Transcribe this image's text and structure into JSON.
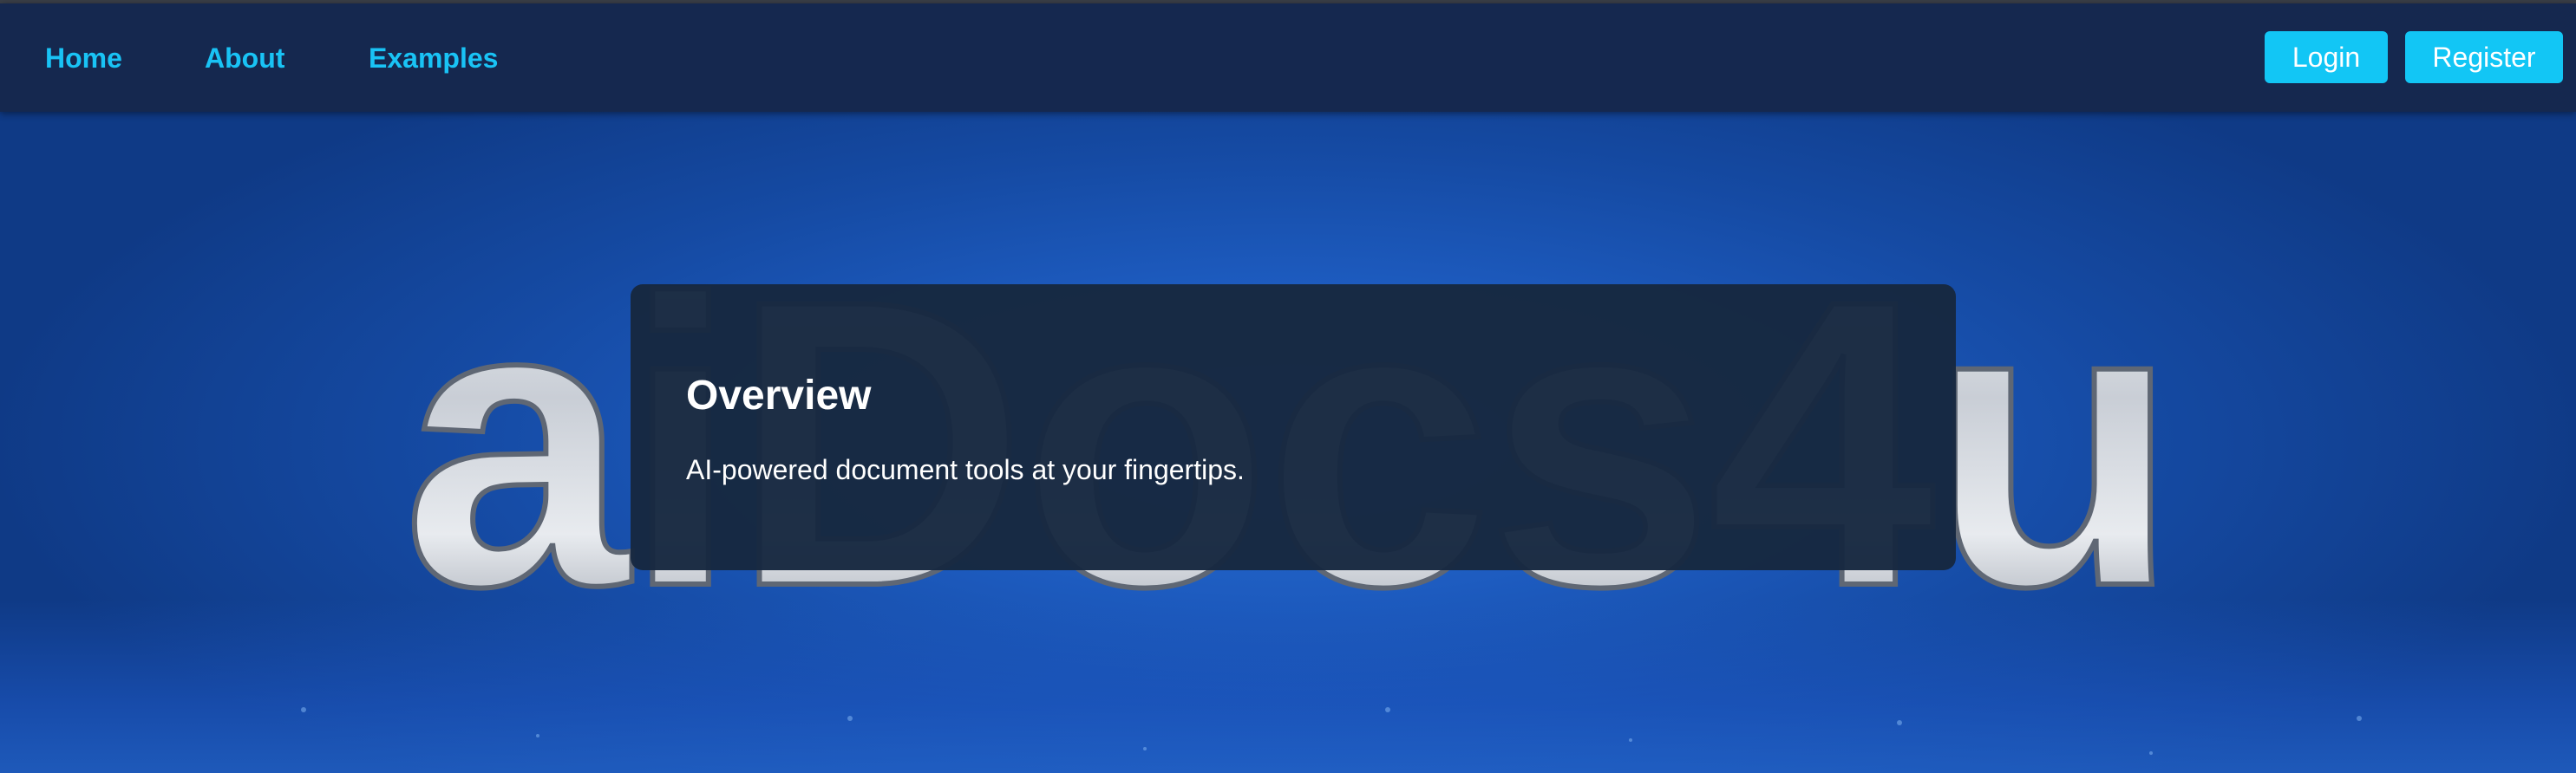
{
  "nav": {
    "links": [
      {
        "label": "Home"
      },
      {
        "label": "About"
      },
      {
        "label": "Examples"
      }
    ],
    "login_label": "Login",
    "register_label": "Register"
  },
  "hero": {
    "logo_text": "aiDocs4u",
    "background_image": "aiDocs4u chrome lettering on blue background"
  },
  "overview": {
    "title": "Overview",
    "text": "AI-powered document tools at your fingertips."
  },
  "colors": {
    "navbar_bg": "#15284f",
    "accent": "#12c6f5",
    "card_bg": "#172840",
    "hero_blue": "#1d5bbf"
  }
}
